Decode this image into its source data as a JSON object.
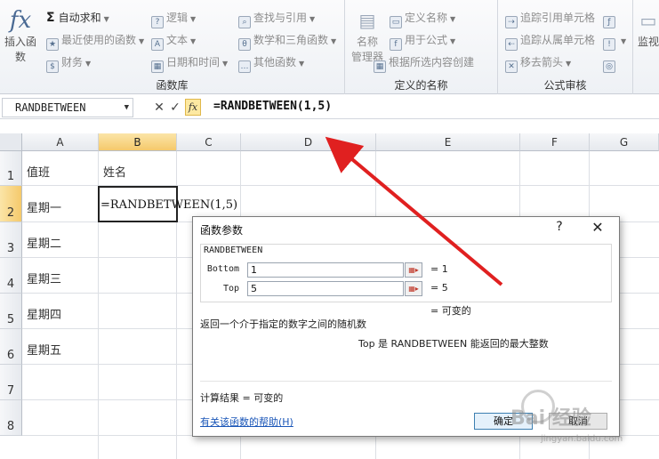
{
  "ribbon": {
    "insert_function_label": "插入函数",
    "insert_function_icon": "fx-icon",
    "autosum_label": "自动求和",
    "recent_label": "最近使用的函数",
    "finance_label": "财务",
    "logical_label": "逻辑",
    "text_label": "文本",
    "datetime_label": "日期和时间",
    "lookup_label": "查找与引用",
    "math_label": "数学和三角函数",
    "other_label": "其他函数",
    "library_group_label": "函数库",
    "name_manager_label_1": "名称",
    "name_manager_label_2": "管理器",
    "define_name_label": "定义名称",
    "use_in_formula_label": "用于公式",
    "create_from_selection_label": "根据所选内容创建",
    "names_group_label": "定义的名称",
    "trace_precedents_label": "追踪引用单元格",
    "trace_dependents_label": "追踪从属单元格",
    "remove_arrows_label": "移去箭头",
    "audit_group_label": "公式审核",
    "watch_label": "监视"
  },
  "formula_bar": {
    "name_box": "RANDBETWEEN",
    "fx_label": "fx",
    "formula": "=RANDBETWEEN(1,5)"
  },
  "grid": {
    "columns": [
      "A",
      "B",
      "C",
      "D",
      "E",
      "F",
      "G"
    ],
    "rows": [
      "1",
      "2",
      "3",
      "4",
      "5",
      "6",
      "7",
      "8"
    ],
    "a1": "值班",
    "b1": "姓名",
    "a2": "星期一",
    "a3": "星期二",
    "a4": "星期三",
    "a5": "星期四",
    "a6": "星期五",
    "b2": "=RANDBETWEEN(1,5)"
  },
  "dialog": {
    "title": "函数参数",
    "help": "?",
    "close": "✕",
    "function_name": "RANDBETWEEN",
    "arg1_label": "Bottom",
    "arg1_value": "1",
    "arg1_result": "=  1",
    "arg2_label": "Top",
    "arg2_value": "5",
    "arg2_result": "=  5",
    "function_result": "=  可变的",
    "description": "返回一个介于指定的数字之间的随机数",
    "arg_description": "Top  是 RANDBETWEEN 能返回的最大整数",
    "calc_result": "计算结果 =  可变的",
    "help_link": "有关该函数的帮助(H)",
    "ok_label": "确定",
    "cancel_label": "取消"
  },
  "watermark": {
    "text": "Bai 经验",
    "sub": "jingyan.baidu.com"
  },
  "colors": {
    "arrow": "#e02020",
    "accent": "#4a6a94"
  }
}
